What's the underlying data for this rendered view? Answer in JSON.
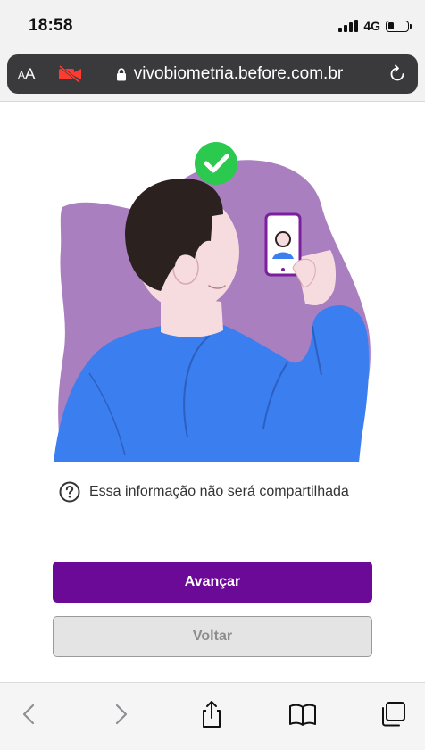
{
  "status_bar": {
    "time": "18:58",
    "network": "4G",
    "battery_level": 0.3
  },
  "browser": {
    "text_size_label": "AA",
    "camera_status_icon": "camera-off-icon",
    "url": "vivobiometria.before.com.br",
    "secure": true,
    "reload_icon": "reload-icon"
  },
  "illustration": {
    "description_icon": "selfie-success-illustration",
    "check_color": "#2cc94f",
    "blob_color": "#a97fc0",
    "shirt_color": "#3b7ef0"
  },
  "info": {
    "icon": "question-circle-icon",
    "text": "Essa informação não será compartilhada"
  },
  "actions": {
    "primary_label": "Avançar",
    "secondary_label": "Voltar",
    "primary_color": "#6a0a96"
  },
  "toolbar": {
    "items": [
      "back-icon",
      "forward-icon",
      "share-icon",
      "bookmarks-icon",
      "tabs-icon"
    ]
  }
}
